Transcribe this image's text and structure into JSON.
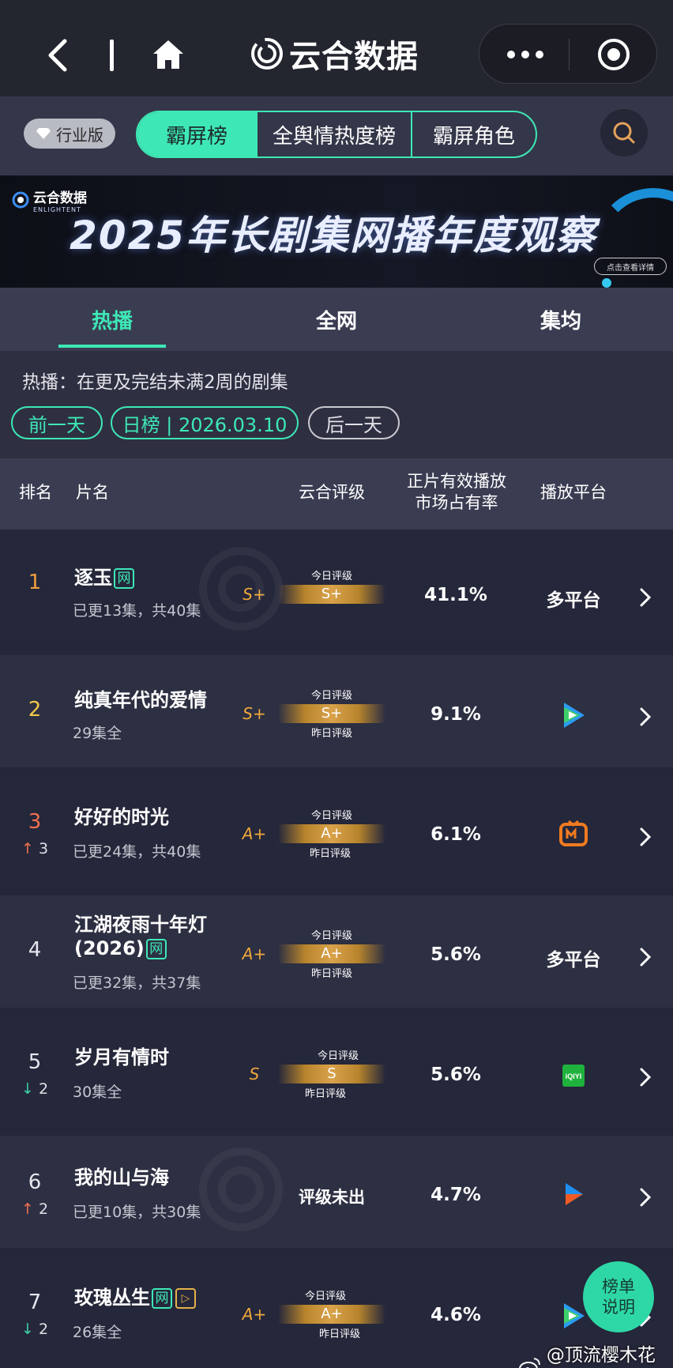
{
  "nav": {
    "title": "云合数据"
  },
  "segment": {
    "edition_badge": "行业版",
    "tabs": [
      {
        "label": "霸屏榜",
        "active": true
      },
      {
        "label": "全舆情热度榜",
        "active": false
      },
      {
        "label": "霸屏角色",
        "active": false
      }
    ]
  },
  "banner": {
    "logo_text": "云合数据",
    "logo_sub": "ENLIGHTENT",
    "title": "2025年长剧集网播年度观察",
    "button": "点击查看详情"
  },
  "tabs": [
    {
      "label": "热播",
      "active": true
    },
    {
      "label": "全网",
      "active": false
    },
    {
      "label": "集均",
      "active": false
    }
  ],
  "info": {
    "description": "热播：在更及完结未满2周的剧集",
    "prev_day": "前一天",
    "date_label": "日榜 | 2026.03.10",
    "next_day": "后一天"
  },
  "table": {
    "headers": {
      "rank": "排名",
      "name": "片名",
      "rating": "云合评级",
      "share_line1": "正片有效播放",
      "share_line2": "市场占有率",
      "platform": "播放平台"
    },
    "today_label": "今日评级",
    "yesterday_label": "昨日评级",
    "rows": [
      {
        "rank": "1",
        "title": "逐玉",
        "tag": "网",
        "extra_tag": "",
        "sub": "已更13集，共40集",
        "grade_side": "S+",
        "grade": "S+",
        "show_yesterday": false,
        "no_rating": "",
        "share": "41.1%",
        "platform_text": "多平台",
        "platform_icon": "",
        "trend_dir": "",
        "trend_val": ""
      },
      {
        "rank": "2",
        "title": "纯真年代的爱情",
        "tag": "",
        "extra_tag": "",
        "sub": "29集全",
        "grade_side": "S+",
        "grade": "S+",
        "show_yesterday": true,
        "no_rating": "",
        "share": "9.1%",
        "platform_text": "",
        "platform_icon": "tencent-video-icon",
        "trend_dir": "",
        "trend_val": ""
      },
      {
        "rank": "3",
        "title": "好好的时光",
        "tag": "",
        "extra_tag": "",
        "sub": "已更24集，共40集",
        "grade_side": "A+",
        "grade": "A+",
        "show_yesterday": true,
        "no_rating": "",
        "share": "6.1%",
        "platform_text": "",
        "platform_icon": "mango-tv-icon",
        "trend_dir": "up",
        "trend_val": "3"
      },
      {
        "rank": "4",
        "title": "江湖夜雨十年灯",
        "title2": "(2026)",
        "tag": "网",
        "extra_tag": "",
        "sub": "已更32集，共37集",
        "grade_side": "A+",
        "grade": "A+",
        "show_yesterday": true,
        "no_rating": "",
        "share": "5.6%",
        "platform_text": "多平台",
        "platform_icon": "",
        "trend_dir": "",
        "trend_val": ""
      },
      {
        "rank": "5",
        "title": "岁月有情时",
        "tag": "",
        "extra_tag": "",
        "sub": "30集全",
        "grade_side": "S",
        "grade": "S",
        "show_yesterday": true,
        "no_rating": "",
        "share": "5.6%",
        "platform_text": "",
        "platform_icon": "iqiyi-icon",
        "trend_dir": "down",
        "trend_val": "2"
      },
      {
        "rank": "6",
        "title": "我的山与海",
        "tag": "",
        "extra_tag": "",
        "sub": "已更10集，共30集",
        "grade_side": "",
        "grade": "",
        "show_yesterday": false,
        "no_rating": "评级未出",
        "share": "4.7%",
        "platform_text": "",
        "platform_icon": "youku-icon",
        "trend_dir": "up",
        "trend_val": "2"
      },
      {
        "rank": "7",
        "title": "玫瑰丛生",
        "tag": "网",
        "extra_tag": "▷",
        "sub": "26集全",
        "grade_side": "A+",
        "grade": "A+",
        "show_yesterday": true,
        "no_rating": "",
        "share": "4.6%",
        "platform_text": "",
        "platform_icon": "tencent-video-icon",
        "trend_dir": "down",
        "trend_val": "2"
      }
    ]
  },
  "fab": {
    "line1": "榜单",
    "line2": "说明"
  },
  "weibo": "@顶流樱木花道",
  "colors": {
    "accent": "#3ee8b6",
    "gold": "#f0a83c",
    "up": "#f07050",
    "down": "#3ecfa6"
  }
}
